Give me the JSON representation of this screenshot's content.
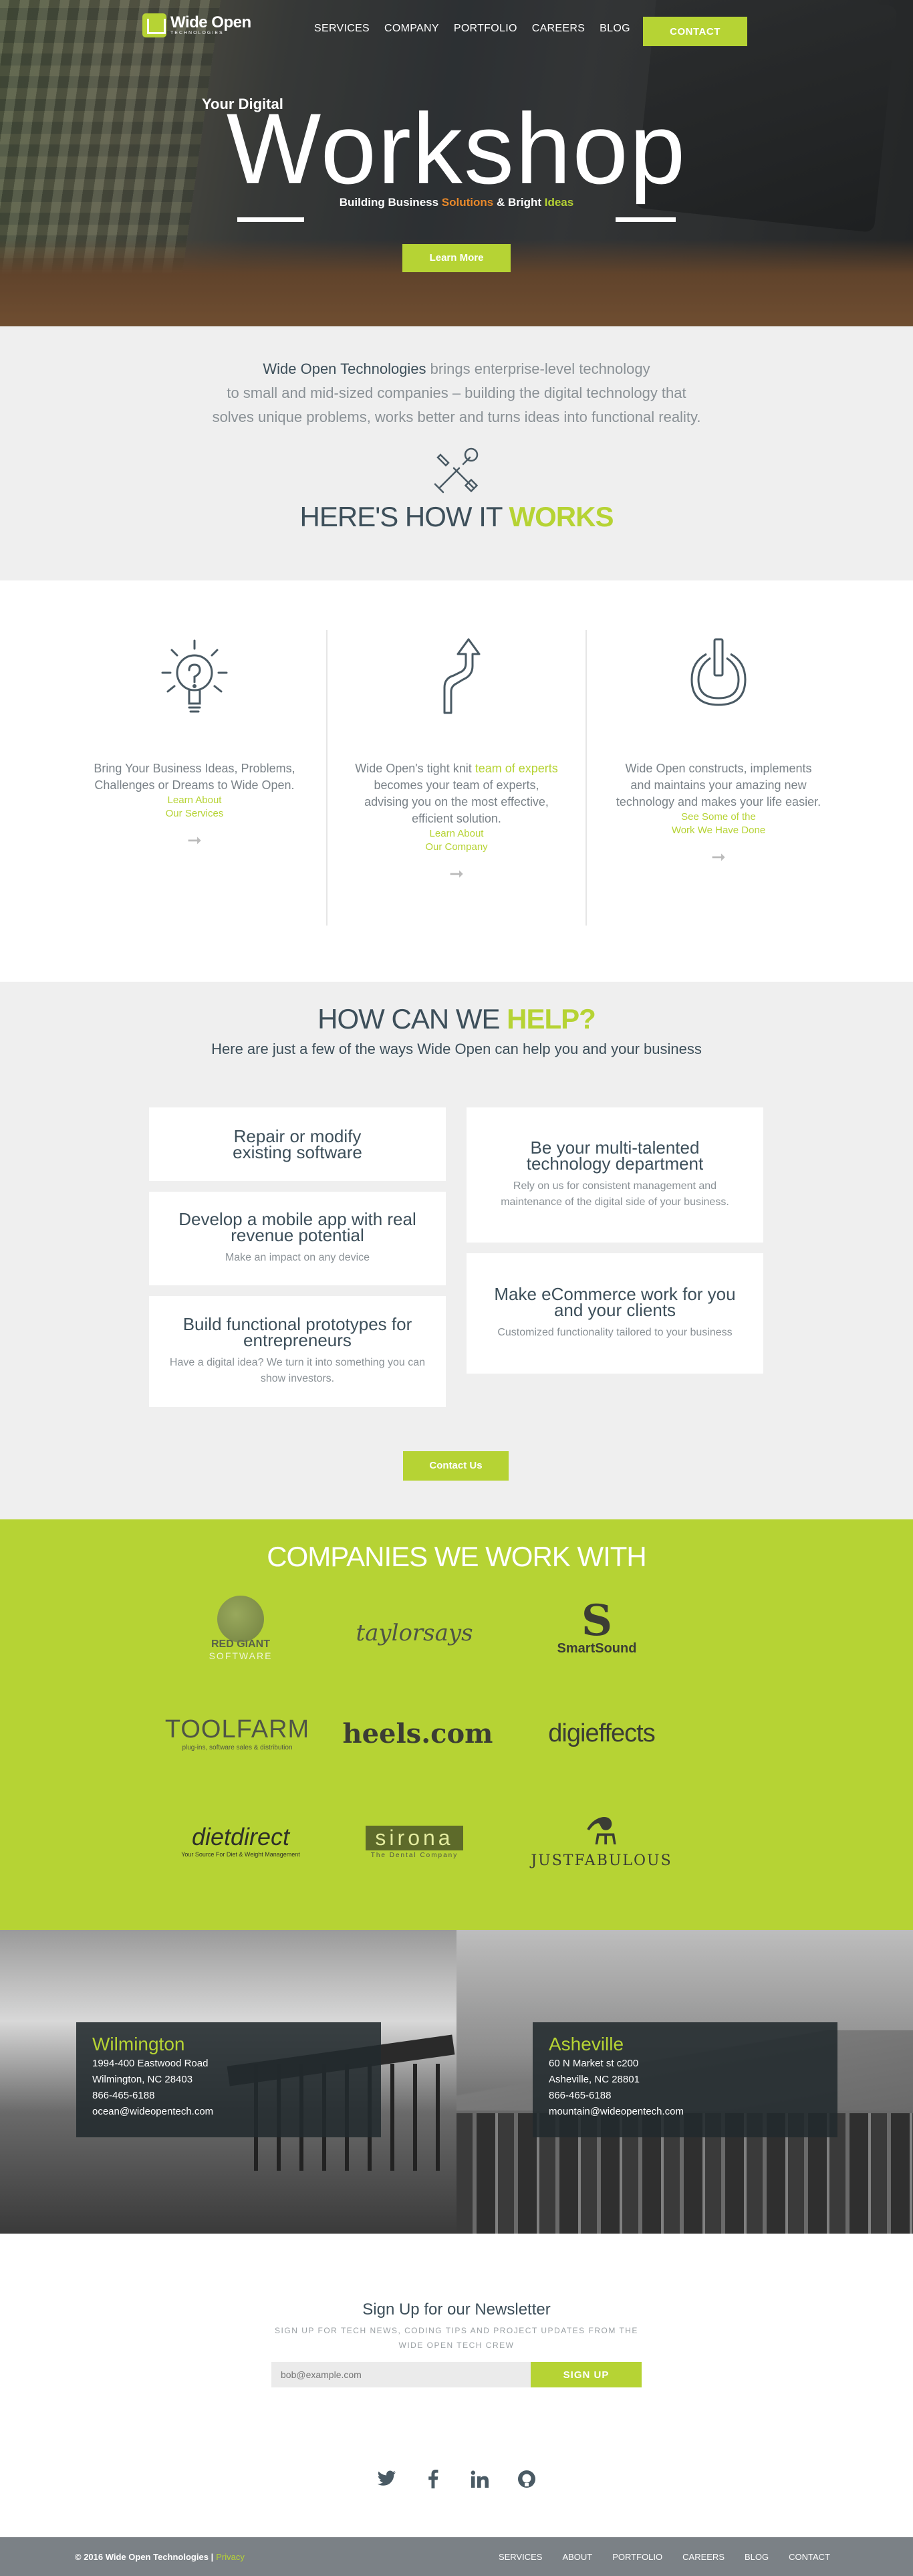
{
  "nav": {
    "logo_name": "Wide Open",
    "logo_sub": "Technologies",
    "items": [
      "SERVICES",
      "COMPANY",
      "PORTFOLIO",
      "CAREERS",
      "BLOG"
    ],
    "contact": "CONTACT"
  },
  "hero": {
    "pre": "Your Digital",
    "title": "Workshop",
    "sub_a": "Building Business ",
    "sub_b": "Solutions",
    "sub_c": " & Bright ",
    "sub_d": "Ideas",
    "button": "Learn More"
  },
  "intro": {
    "company": "Wide Open Technologies",
    "text_a": " brings enterprise-level technology",
    "text_b": "to small and mid-sized companies – building the digital technology that",
    "text_c": "solves unique problems, works better and turns ideas into functional reality.",
    "title_a": "HERE'S HOW IT ",
    "title_b": "WORKS"
  },
  "how": [
    {
      "text": "Bring Your Business Ideas, Problems, Challenges or Dreams to Wide Open.",
      "link_a": "Learn About",
      "link_b": "Our Services"
    },
    {
      "text_a": "Wide Open's tight knit ",
      "highlight": "team of experts",
      "text_b": " becomes your team of experts, advising you on the most effective, efficient solution.",
      "link_a": "Learn About",
      "link_b": "Our Company"
    },
    {
      "text": "Wide Open constructs, implements and maintains your amazing new technology and makes your life easier.",
      "link_a": "See Some of the",
      "link_b": "Work We Have Done"
    }
  ],
  "help": {
    "title_a": "HOW CAN WE ",
    "title_b": "HELP?",
    "sub": "Here are just a few of the ways Wide Open can help you and your business",
    "cards": [
      {
        "title": "Repair or modify existing software",
        "desc": ""
      },
      {
        "title": "Develop a mobile app with real revenue potential",
        "desc": "Make an impact on any device"
      },
      {
        "title": "Build functional prototypes for entrepreneurs",
        "desc": "Have a digital idea? We turn it into something you can show investors."
      },
      {
        "title": "Be your multi-talented technology department",
        "desc": "Rely on us for consistent management and maintenance of the digital side of your business."
      },
      {
        "title": "Make eCommerce work for you and your clients",
        "desc": "Customized functionality tailored to your business"
      }
    ],
    "button": "Contact Us"
  },
  "companies": {
    "title": "COMPANIES WE WORK WITH",
    "logos": [
      "RED GIANT",
      "SOFTWARE",
      "taylorsays",
      "SmartSound",
      "TOOLFARM",
      "plug-ins, software sales & distribution",
      "heels.com",
      "digieffects",
      "dietdirect",
      "Your Source For Diet & Weight Management",
      "sirona",
      "The Dental Company",
      "JUSTFABULOUS"
    ]
  },
  "locations": [
    {
      "city": "Wilmington",
      "addr1": "1994-400 Eastwood Road",
      "addr2": "Wilmington, NC 28403",
      "phone": "866-465-6188",
      "email": "ocean@wideopentech.com"
    },
    {
      "city": "Asheville",
      "addr1": "60 N Market st c200",
      "addr2": "Asheville, NC 28801",
      "phone": "866-465-6188",
      "email": "mountain@wideopentech.com"
    }
  ],
  "newsletter": {
    "title": "Sign Up for our Newsletter",
    "desc_a": "SIGN UP FOR TECH NEWS, CODING TIPS AND PROJECT UPDATES FROM THE",
    "desc_b": "WIDE OPEN TECH CREW",
    "placeholder": "bob@example.com",
    "button": "SIGN UP"
  },
  "social": [
    "twitter-icon",
    "facebook-icon",
    "linkedin-icon",
    "github-icon"
  ],
  "footer": {
    "copyright": "© 2016 Wide Open Technologies",
    "separator": "|",
    "privacy": "Privacy",
    "items": [
      "SERVICES",
      "ABOUT",
      "PORTFOLIO",
      "CAREERS",
      "BLOG",
      "CONTACT"
    ]
  },
  "colors": {
    "accent": "#b6d334",
    "dark": "#3d4f5a",
    "orange": "#e8882a",
    "footer": "#7b8186"
  }
}
